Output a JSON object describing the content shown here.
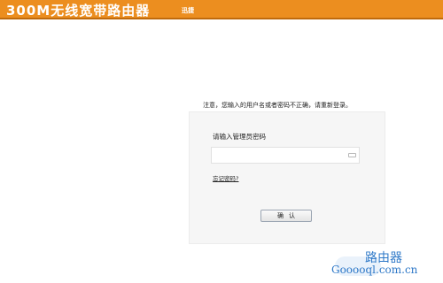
{
  "header": {
    "title": "300M无线宽带路由器",
    "brand": "迅捷"
  },
  "login": {
    "error_message": "注意，您输入的用户名或者密码不正确，请重新登录。",
    "password_label": "请输入管理员密码",
    "password_value": "",
    "forgot_link": "忘记密码?",
    "confirm_button": "确认"
  },
  "watermark": {
    "top_text": "路由器",
    "bottom_text": "Gooooql.com.cn"
  },
  "colors": {
    "header_bg": "#ec8e1f",
    "panel_bg": "#f6f6f6",
    "watermark": "#2f79c8"
  }
}
